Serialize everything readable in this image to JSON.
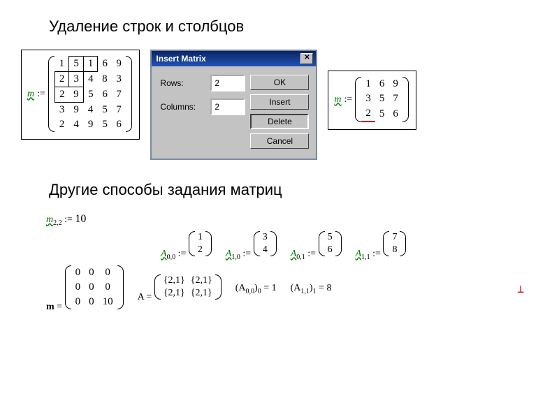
{
  "heading1": "Удаление строк и столбцов",
  "heading2": "Другие способы задания матриц",
  "left_matrix": {
    "var": "m",
    "op": ":=",
    "rows": [
      [
        "1",
        "5",
        "1",
        "6",
        "9"
      ],
      [
        "2",
        "3",
        "4",
        "8",
        "3"
      ],
      [
        "2",
        "9",
        "5",
        "6",
        "7"
      ],
      [
        "3",
        "9",
        "4",
        "5",
        "7"
      ],
      [
        "2",
        "4",
        "9",
        "5",
        "6"
      ]
    ]
  },
  "dialog": {
    "title": "Insert Matrix",
    "rows_label": "Rows:",
    "cols_label": "Columns:",
    "rows_value": "2",
    "cols_value": "2",
    "btn_ok": "OK",
    "btn_insert": "Insert",
    "btn_delete": "Delete",
    "btn_cancel": "Cancel",
    "close_glyph": "✕"
  },
  "right_matrix": {
    "var": "m",
    "op": ":=",
    "rows": [
      [
        "1",
        "6",
        "9"
      ],
      [
        "3",
        "5",
        "7"
      ],
      [
        "2",
        "5",
        "6"
      ]
    ]
  },
  "elem_assign": {
    "var": "m",
    "idx": "2,2",
    "op": ":=",
    "val": "10"
  },
  "A_defs": [
    {
      "var": "A",
      "idx": "0,0",
      "op": ":=",
      "col": [
        "1",
        "2"
      ]
    },
    {
      "var": "A",
      "idx": "1,0",
      "op": ":=",
      "col": [
        "3",
        "4"
      ]
    },
    {
      "var": "A",
      "idx": "0,1",
      "op": ":=",
      "col": [
        "5",
        "6"
      ]
    },
    {
      "var": "A",
      "idx": "1,1",
      "op": ":=",
      "col": [
        "7",
        "8"
      ]
    }
  ],
  "m_result": {
    "var": "m",
    "op": "=",
    "rows": [
      [
        "0",
        "0",
        "0"
      ],
      [
        "0",
        "0",
        "0"
      ],
      [
        "0",
        "0",
        "10"
      ]
    ]
  },
  "A_block": {
    "var": "A",
    "op": "=",
    "rows": [
      [
        "{2,1}",
        "{2,1}"
      ],
      [
        "{2,1}",
        "{2,1}"
      ]
    ]
  },
  "A_idx1": {
    "expr_left": "(A",
    "sub1": "0,0",
    "mid": ")",
    "sub2": "0",
    "op": "= ",
    "val": "1"
  },
  "A_idx2": {
    "expr_left": "(A",
    "sub1": "1,1",
    "mid": ")",
    "sub2": "1",
    "op": "= ",
    "val": "8"
  },
  "cursor_glyph": "⊥"
}
